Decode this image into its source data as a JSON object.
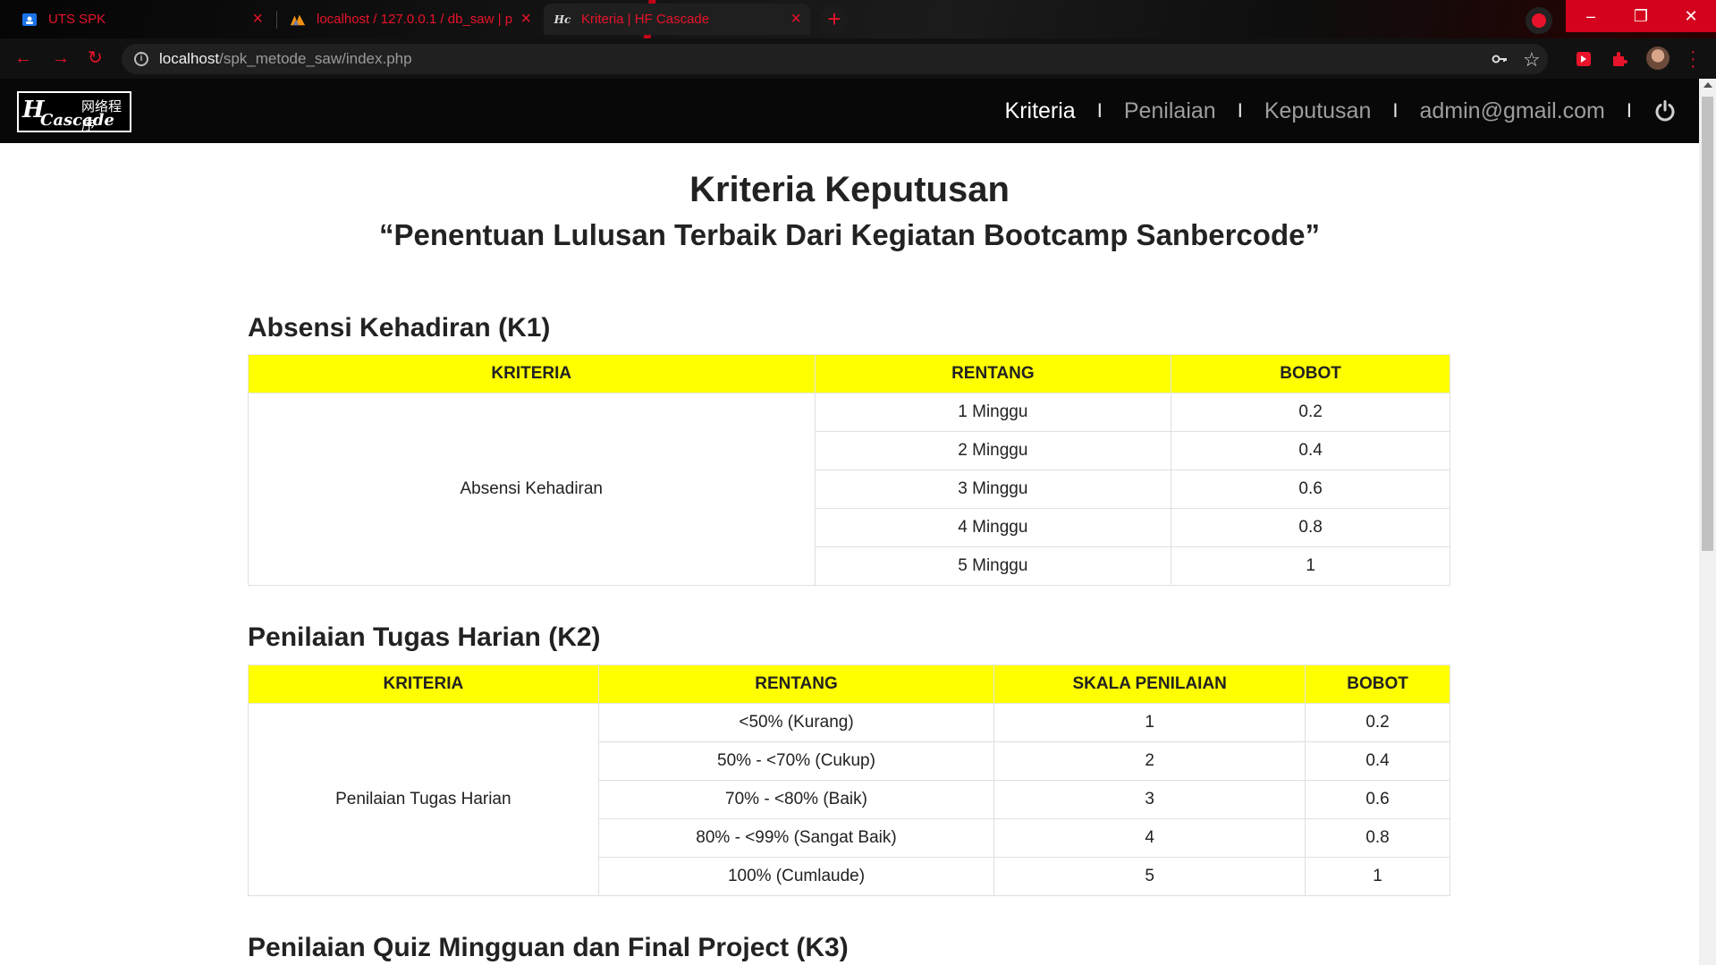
{
  "browser": {
    "tabs": [
      {
        "title": "UTS SPK"
      },
      {
        "title": "localhost / 127.0.0.1 / db_saw | p"
      },
      {
        "title": "Kriteria | HF Cascade"
      }
    ],
    "url_host": "localhost",
    "url_path": "/spk_metode_saw/index.php"
  },
  "site": {
    "logo_script": "H",
    "logo_word": "Cascade",
    "logo_cjk": "网络程序",
    "nav": [
      {
        "label": "Kriteria"
      },
      {
        "label": "Penilaian"
      },
      {
        "label": "Keputusan"
      },
      {
        "label": "admin@gmail.com"
      }
    ],
    "nav_sep": "I"
  },
  "page": {
    "title": "Kriteria Keputusan",
    "subtitle": "“Penentuan Lulusan Terbaik Dari Kegiatan Bootcamp Sanbercode”"
  },
  "sections": [
    {
      "title": "Absensi Kehadiran (K1)",
      "headers": [
        "KRITERIA",
        "RENTANG",
        "BOBOT"
      ],
      "criteria": "Absensi Kehadiran",
      "rows": [
        [
          "1 Minggu",
          "0.2"
        ],
        [
          "2 Minggu",
          "0.4"
        ],
        [
          "3 Minggu",
          "0.6"
        ],
        [
          "4 Minggu",
          "0.8"
        ],
        [
          "5 Minggu",
          "1"
        ]
      ]
    },
    {
      "title": "Penilaian Tugas Harian (K2)",
      "headers": [
        "KRITERIA",
        "RENTANG",
        "SKALA PENILAIAN",
        "BOBOT"
      ],
      "criteria": "Penilaian Tugas Harian",
      "rows": [
        [
          "<50% (Kurang)",
          "1",
          "0.2"
        ],
        [
          "50% - <70% (Cukup)",
          "2",
          "0.4"
        ],
        [
          "70% - <80% (Baik)",
          "3",
          "0.6"
        ],
        [
          "80% - <99% (Sangat Baik)",
          "4",
          "0.8"
        ],
        [
          "100% (Cumlaude)",
          "5",
          "1"
        ]
      ]
    },
    {
      "title": "Penilaian Quiz Mingguan dan Final Project (K3)"
    }
  ],
  "colors": {
    "header_bg": "#080808",
    "table_head": "#ffff00",
    "chrome_accent": "#e8132a"
  }
}
